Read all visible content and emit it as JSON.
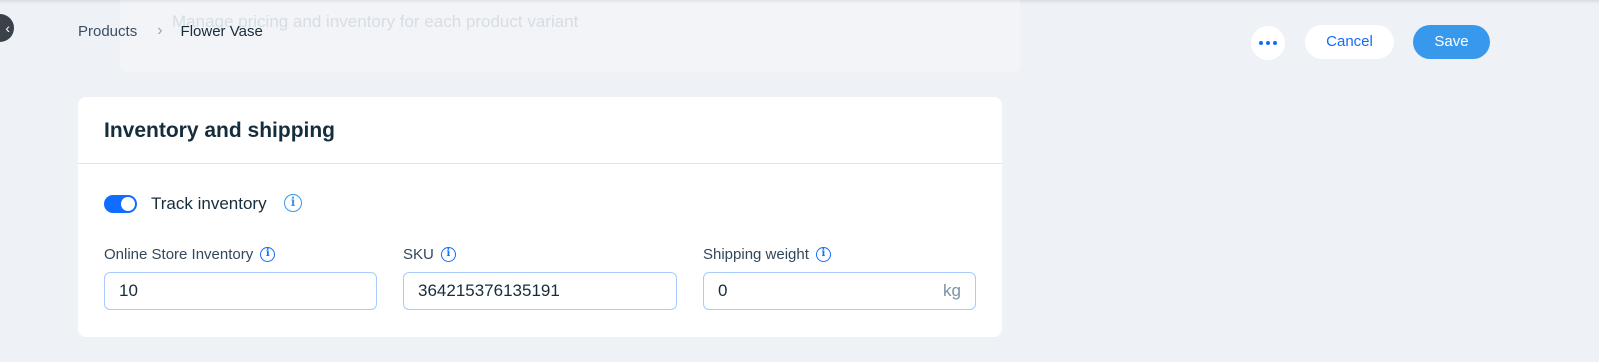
{
  "background_text": "Manage pricing and inventory for each product variant",
  "breadcrumb": {
    "parent": "Products",
    "separator": "›",
    "current": "Flower Vase"
  },
  "actions": {
    "more_icon": "more-horizontal-icon",
    "cancel_label": "Cancel",
    "save_label": "Save"
  },
  "card": {
    "title": "Inventory and shipping",
    "track_inventory": {
      "label": "Track inventory",
      "enabled": true
    },
    "fields": {
      "inventory": {
        "label": "Online Store Inventory",
        "value": "10"
      },
      "sku": {
        "label": "SKU",
        "value": "364215376135191"
      },
      "weight": {
        "label": "Shipping weight",
        "value": "0",
        "unit": "kg"
      }
    }
  },
  "colors": {
    "accent": "#116dff",
    "save_button": "#3899ec",
    "page_background": "#eef1f6"
  }
}
